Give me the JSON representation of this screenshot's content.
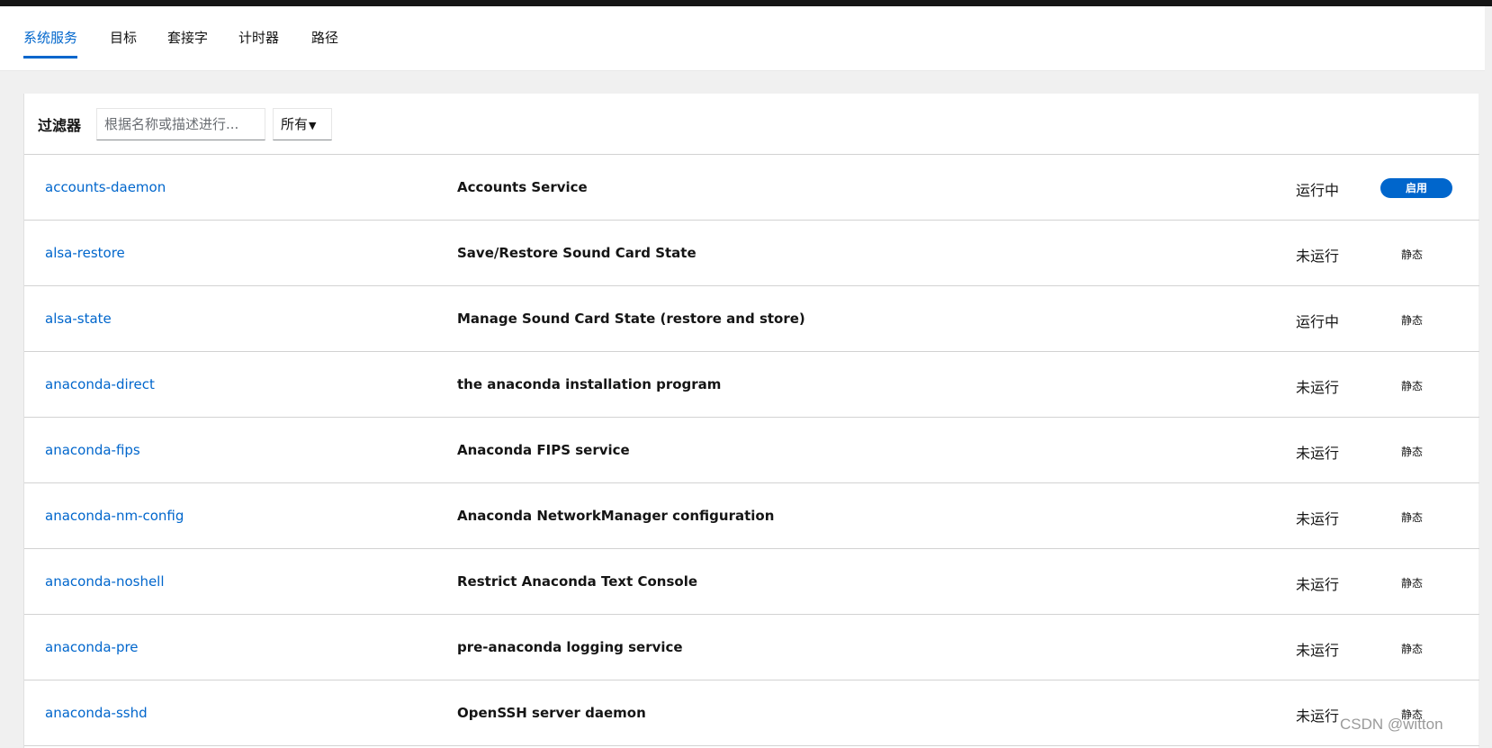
{
  "tabs": [
    "系统服务",
    "目标",
    "套接字",
    "计时器",
    "路径"
  ],
  "filter": {
    "label": "过滤器",
    "placeholder": "根据名称或描述进行...",
    "select_value": "所有"
  },
  "services": [
    {
      "name": "accounts-daemon",
      "description": "Accounts Service",
      "status": "运行中",
      "state": "启用"
    },
    {
      "name": "alsa-restore",
      "description": "Save/Restore Sound Card State",
      "status": "未运行",
      "state": "静态"
    },
    {
      "name": "alsa-state",
      "description": "Manage Sound Card State (restore and store)",
      "status": "运行中",
      "state": "静态"
    },
    {
      "name": "anaconda-direct",
      "description": "the anaconda installation program",
      "status": "未运行",
      "state": "静态"
    },
    {
      "name": "anaconda-fips",
      "description": "Anaconda FIPS service",
      "status": "未运行",
      "state": "静态"
    },
    {
      "name": "anaconda-nm-config",
      "description": "Anaconda NetworkManager configuration",
      "status": "未运行",
      "state": "静态"
    },
    {
      "name": "anaconda-noshell",
      "description": "Restrict Anaconda Text Console",
      "status": "未运行",
      "state": "静态"
    },
    {
      "name": "anaconda-pre",
      "description": "pre-anaconda logging service",
      "status": "未运行",
      "state": "静态"
    },
    {
      "name": "anaconda-sshd",
      "description": "OpenSSH server daemon",
      "status": "未运行",
      "state": "静态"
    }
  ],
  "watermark": "CSDN @witton",
  "colors": {
    "accent": "#0066cc",
    "topbar": "#151515",
    "background": "#f0f0f0"
  }
}
